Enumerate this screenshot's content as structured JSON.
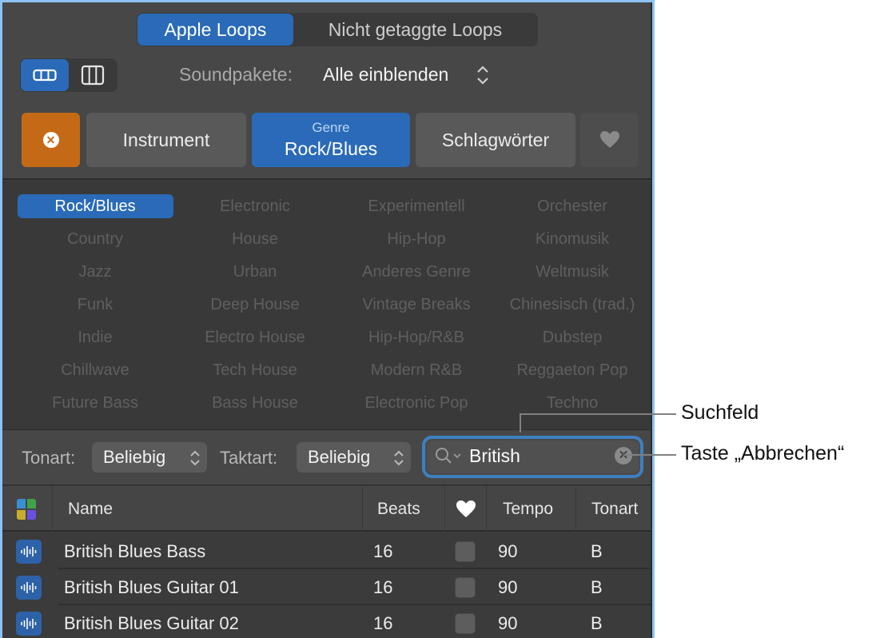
{
  "tabs": [
    {
      "label": "Apple Loops",
      "active": true
    },
    {
      "label": "Nicht getaggte Loops",
      "active": false
    }
  ],
  "view_toggle": [
    {
      "icon": "button-view-icon",
      "active": true
    },
    {
      "icon": "column-view-icon",
      "active": false
    }
  ],
  "soundpacks": {
    "label": "Soundpakete:",
    "value": "Alle einblenden"
  },
  "filter_buttons": {
    "clear_icon": "clear-icon",
    "instrument": "Instrument",
    "genre_caption": "Genre",
    "genre_value": "Rock/Blues",
    "keywords": "Schlagwörter",
    "favorites_icon": "heart-icon"
  },
  "genres": [
    [
      "Rock/Blues",
      "Electronic",
      "Experimentell",
      "Orchester"
    ],
    [
      "Country",
      "House",
      "Hip-Hop",
      "Kinomusik"
    ],
    [
      "Jazz",
      "Urban",
      "Anderes Genre",
      "Weltmusik"
    ],
    [
      "Funk",
      "Deep House",
      "Vintage Breaks",
      "Chinesisch (trad.)"
    ],
    [
      "Indie",
      "Electro House",
      "Hip-Hop/R&B",
      "Dubstep"
    ],
    [
      "Chillwave",
      "Tech House",
      "Modern R&B",
      "Reggaeton Pop"
    ],
    [
      "Future Bass",
      "Bass House",
      "Electronic Pop",
      "Techno"
    ]
  ],
  "selected_genre": "Rock/Blues",
  "filters": {
    "key_label": "Tonart:",
    "key_value": "Beliebig",
    "meter_label": "Taktart:",
    "meter_value": "Beliebig",
    "search_value": "British"
  },
  "table": {
    "columns": [
      "Name",
      "Beats",
      "Tempo",
      "Tonart"
    ],
    "rows": [
      {
        "name": "British Blues Bass",
        "beats": "16",
        "favorite": false,
        "tempo": "90",
        "key": "B"
      },
      {
        "name": "British Blues Guitar 01",
        "beats": "16",
        "favorite": false,
        "tempo": "90",
        "key": "B"
      },
      {
        "name": "British Blues Guitar 02",
        "beats": "16",
        "favorite": false,
        "tempo": "90",
        "key": "B"
      }
    ]
  },
  "callouts": {
    "search_field": "Suchfeld",
    "cancel_button": "Taste „Abbrechen“"
  },
  "colors": {
    "accent_blue": "#2a6ab8",
    "clear_orange": "#c46a16",
    "focus_ring": "#3d80c0"
  }
}
